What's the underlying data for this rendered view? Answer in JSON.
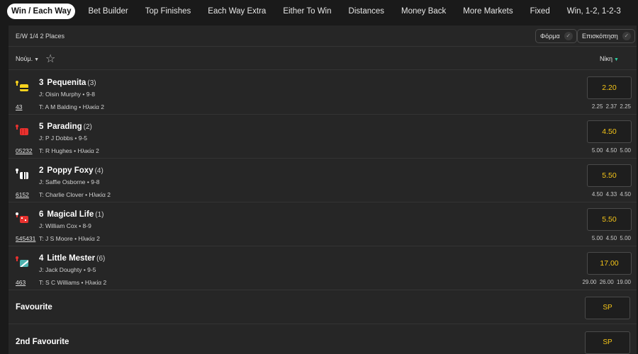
{
  "tabs": [
    {
      "label": "Win / Each Way",
      "active": true
    },
    {
      "label": "Bet Builder"
    },
    {
      "label": "Top Finishes"
    },
    {
      "label": "Each Way Extra"
    },
    {
      "label": "Either To Win"
    },
    {
      "label": "Distances"
    },
    {
      "label": "Money Back"
    },
    {
      "label": "More Markets"
    },
    {
      "label": "Fixed"
    },
    {
      "label": "Win, 1-2, 1-2-3"
    }
  ],
  "panel": {
    "ew_terms": "E/W 1/4 2 Places",
    "form_toggle": "Φόρμα",
    "overview_toggle": "Επισκόπηση",
    "sort_label": "Νούμ.",
    "win_column": "Νίκη"
  },
  "runners": [
    {
      "number": "3",
      "name": "Pequenita",
      "draw": "(3)",
      "jockey": "J: Oisin Murphy • 9-8",
      "form": "43",
      "trainer": "T: A M Balding • Ηλικία 2",
      "odds": "2.20",
      "prev": "2.25 2.37 2.25",
      "silk": "yellow"
    },
    {
      "number": "5",
      "name": "Parading",
      "draw": "(2)",
      "jockey": "J: P J Dobbs • 9-5",
      "form": "05232",
      "trainer": "T: R Hughes • Ηλικία 2",
      "odds": "4.50",
      "prev": "5.00 4.50 5.00",
      "silk": "red"
    },
    {
      "number": "2",
      "name": "Poppy Foxy",
      "draw": "(4)",
      "jockey": "J: Saffie Osborne • 9-8",
      "form": "6152",
      "trainer": "T: Charlie Clover • Ηλικία 2",
      "odds": "5.50",
      "prev": "4.50 4.33 4.50",
      "silk": "white"
    },
    {
      "number": "6",
      "name": "Magical Life",
      "draw": "(1)",
      "jockey": "J: William Cox • 8-9",
      "form": "545431",
      "trainer": "T: J S Moore • Ηλικία 2",
      "odds": "5.50",
      "prev": "5.00 4.50 5.00",
      "silk": "redwhite"
    },
    {
      "number": "4",
      "name": "Little Mester",
      "draw": "(6)",
      "jockey": "J: Jack Doughty • 9-5",
      "form": "463",
      "trainer": "T: S C Williams • Ηλικία 2",
      "odds": "17.00",
      "prev": "29.00 26.00 19.00",
      "silk": "teal"
    }
  ],
  "specials": [
    {
      "label": "Favourite",
      "odds": "SP"
    },
    {
      "label": "2nd Favourite",
      "odds": "SP"
    }
  ],
  "colors": {
    "odds": "#f5c518",
    "accent": "#2bd3a4"
  }
}
